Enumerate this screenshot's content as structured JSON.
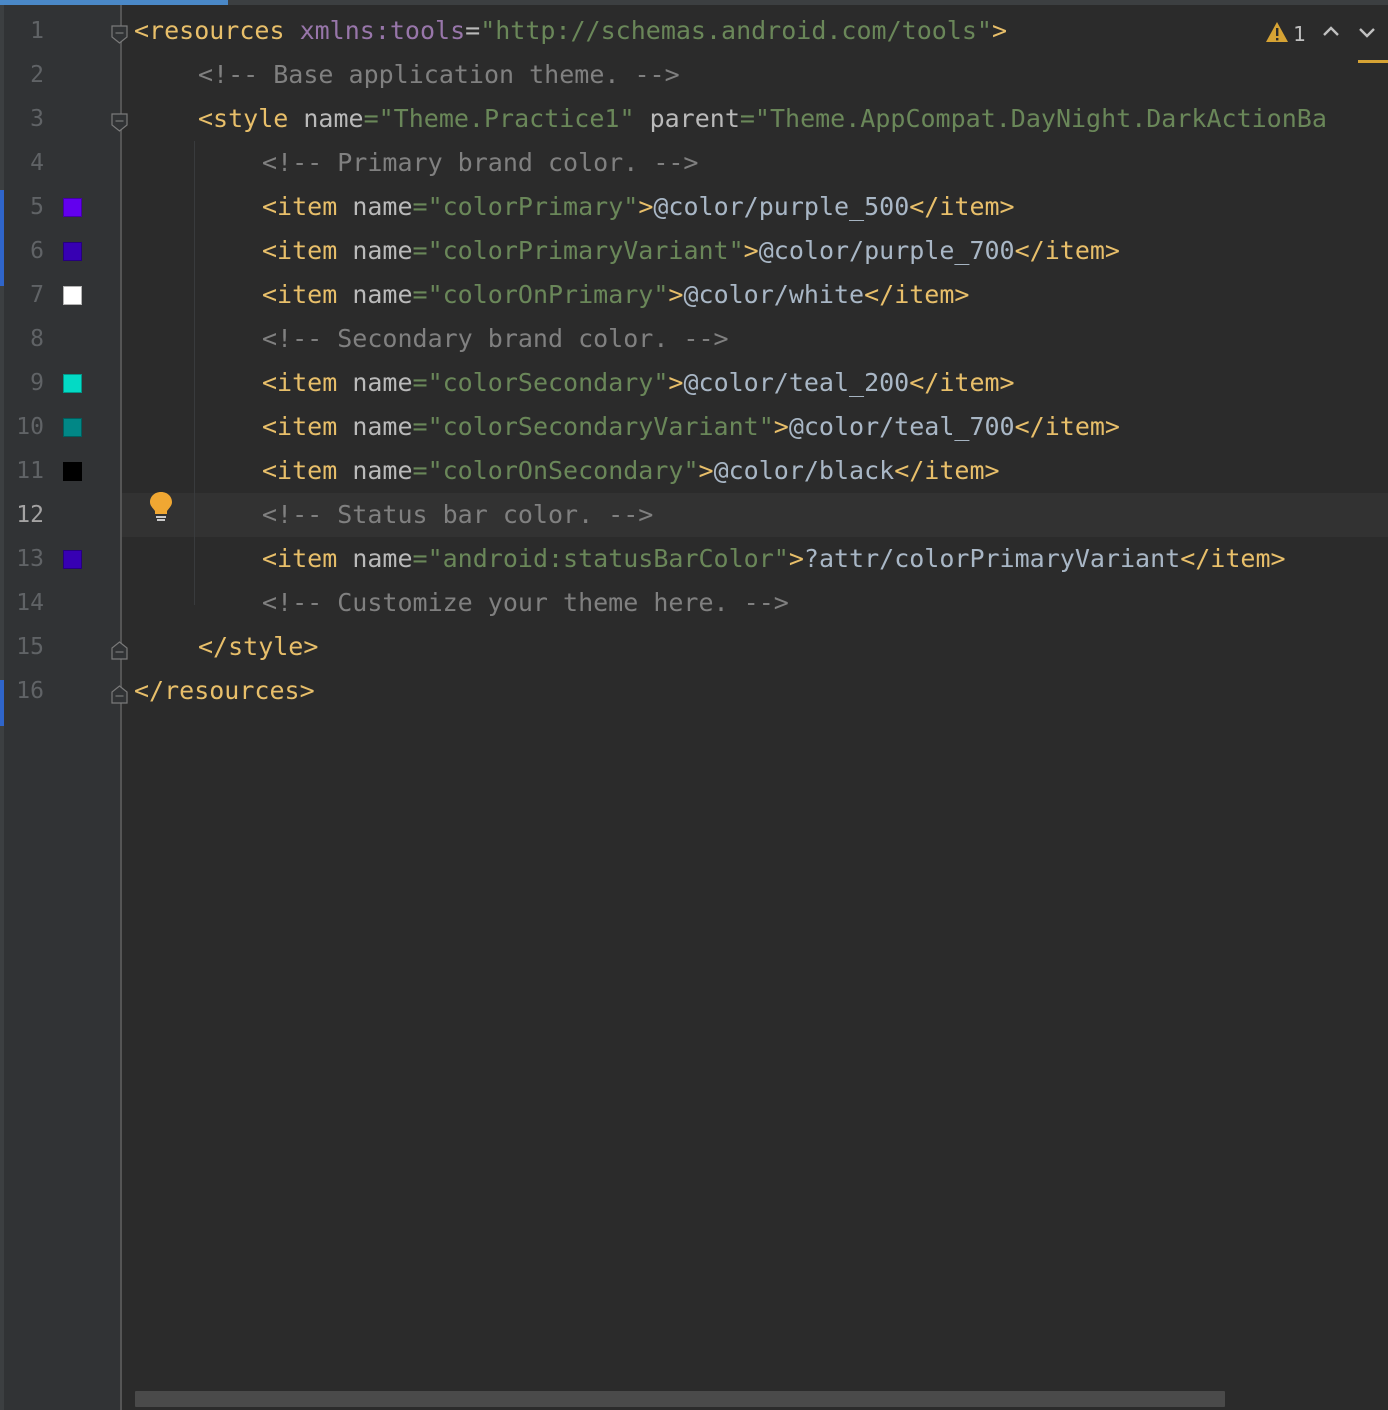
{
  "editor": {
    "file_language": "xml",
    "current_line": 12,
    "lines": [
      {
        "number": "1",
        "indent": 0,
        "fold": "open",
        "tokens": [
          {
            "t": "tag",
            "v": "<resources"
          },
          {
            "t": "ns",
            "v": " xmlns:tools"
          },
          {
            "t": "attr",
            "v": "="
          },
          {
            "t": "val",
            "v": "\"http://schemas.android.com/tools\""
          },
          {
            "t": "tag",
            "v": ">"
          }
        ]
      },
      {
        "number": "2",
        "indent": 1,
        "tokens": [
          {
            "t": "comment",
            "v": "<!-- Base application theme. -->"
          }
        ]
      },
      {
        "number": "3",
        "indent": 1,
        "fold": "open",
        "tokens": [
          {
            "t": "tag",
            "v": "<style"
          },
          {
            "t": "attr",
            "v": " name"
          },
          {
            "t": "val",
            "v": "=\"Theme.Practice1\""
          },
          {
            "t": "attr",
            "v": " parent"
          },
          {
            "t": "val",
            "v": "=\"Theme.AppCompat.DayNight.DarkActionBa"
          }
        ]
      },
      {
        "number": "4",
        "indent": 2,
        "tokens": [
          {
            "t": "comment",
            "v": "<!-- Primary brand color. -->"
          }
        ]
      },
      {
        "number": "5",
        "indent": 2,
        "swatch": "#6200ee",
        "tokens": [
          {
            "t": "tag",
            "v": "<item"
          },
          {
            "t": "attr",
            "v": " name"
          },
          {
            "t": "val",
            "v": "=\"colorPrimary\""
          },
          {
            "t": "tag",
            "v": ">"
          },
          {
            "t": "text",
            "v": "@color/purple_500"
          },
          {
            "t": "tag",
            "v": "</item>"
          }
        ]
      },
      {
        "number": "6",
        "indent": 2,
        "swatch": "#3700b3",
        "tokens": [
          {
            "t": "tag",
            "v": "<item"
          },
          {
            "t": "attr",
            "v": " name"
          },
          {
            "t": "val",
            "v": "=\"colorPrimaryVariant\""
          },
          {
            "t": "tag",
            "v": ">"
          },
          {
            "t": "text",
            "v": "@color/purple_700"
          },
          {
            "t": "tag",
            "v": "</item>"
          }
        ]
      },
      {
        "number": "7",
        "indent": 2,
        "swatch": "#ffffff",
        "tokens": [
          {
            "t": "tag",
            "v": "<item"
          },
          {
            "t": "attr",
            "v": " name"
          },
          {
            "t": "val",
            "v": "=\"colorOnPrimary\""
          },
          {
            "t": "tag",
            "v": ">"
          },
          {
            "t": "text",
            "v": "@color/white"
          },
          {
            "t": "tag",
            "v": "</item>"
          }
        ]
      },
      {
        "number": "8",
        "indent": 2,
        "tokens": [
          {
            "t": "comment",
            "v": "<!-- Secondary brand color. -->"
          }
        ]
      },
      {
        "number": "9",
        "indent": 2,
        "swatch": "#03dac5",
        "tokens": [
          {
            "t": "tag",
            "v": "<item"
          },
          {
            "t": "attr",
            "v": " name"
          },
          {
            "t": "val",
            "v": "=\"colorSecondary\""
          },
          {
            "t": "tag",
            "v": ">"
          },
          {
            "t": "text",
            "v": "@color/teal_200"
          },
          {
            "t": "tag",
            "v": "</item>"
          }
        ]
      },
      {
        "number": "10",
        "indent": 2,
        "swatch": "#018786",
        "tokens": [
          {
            "t": "tag",
            "v": "<item"
          },
          {
            "t": "attr",
            "v": " name"
          },
          {
            "t": "val",
            "v": "=\"colorSecondaryVariant\""
          },
          {
            "t": "tag",
            "v": ">"
          },
          {
            "t": "text",
            "v": "@color/teal_700"
          },
          {
            "t": "tag",
            "v": "</item>"
          }
        ]
      },
      {
        "number": "11",
        "indent": 2,
        "swatch": "#000000",
        "tokens": [
          {
            "t": "tag",
            "v": "<item"
          },
          {
            "t": "attr",
            "v": " name"
          },
          {
            "t": "val",
            "v": "=\"colorOnSecondary\""
          },
          {
            "t": "tag",
            "v": ">"
          },
          {
            "t": "text",
            "v": "@color/black"
          },
          {
            "t": "tag",
            "v": "</item>"
          }
        ]
      },
      {
        "number": "12",
        "indent": 2,
        "tokens": [
          {
            "t": "comment",
            "v": "<!-- Status bar color. -->"
          }
        ]
      },
      {
        "number": "13",
        "indent": 2,
        "swatch": "#3700b3",
        "tokens": [
          {
            "t": "tag",
            "v": "<item"
          },
          {
            "t": "attr",
            "v": " name"
          },
          {
            "t": "val",
            "v": "=\"android:statusBarColor\""
          },
          {
            "t": "tag",
            "v": ">"
          },
          {
            "t": "text",
            "v": "?attr/colorPrimaryVariant"
          },
          {
            "t": "tag",
            "v": "</item>"
          }
        ]
      },
      {
        "number": "14",
        "indent": 2,
        "tokens": [
          {
            "t": "comment",
            "v": "<!-- Customize your theme here. -->"
          }
        ]
      },
      {
        "number": "15",
        "indent": 1,
        "fold": "close",
        "tokens": [
          {
            "t": "tag",
            "v": "</style>"
          }
        ]
      },
      {
        "number": "16",
        "indent": 0,
        "fold": "close",
        "tokens": [
          {
            "t": "tag",
            "v": "</resources>"
          }
        ]
      }
    ]
  },
  "inspection_widget": {
    "warning_count": "1",
    "warning_icon": "warning-triangle-icon",
    "prev_icon": "chevron-up-icon",
    "next_icon": "chevron-down-icon"
  },
  "intention_icon": "lightbulb-icon",
  "colors": {
    "background": "#2b2b2b",
    "gutter": "#313335",
    "current_line": "#323232",
    "tag": "#e8bf6a",
    "attribute": "#bababa",
    "value": "#6a8759",
    "comment": "#808080",
    "text": "#a9b7c6",
    "warning": "#d6a334"
  }
}
